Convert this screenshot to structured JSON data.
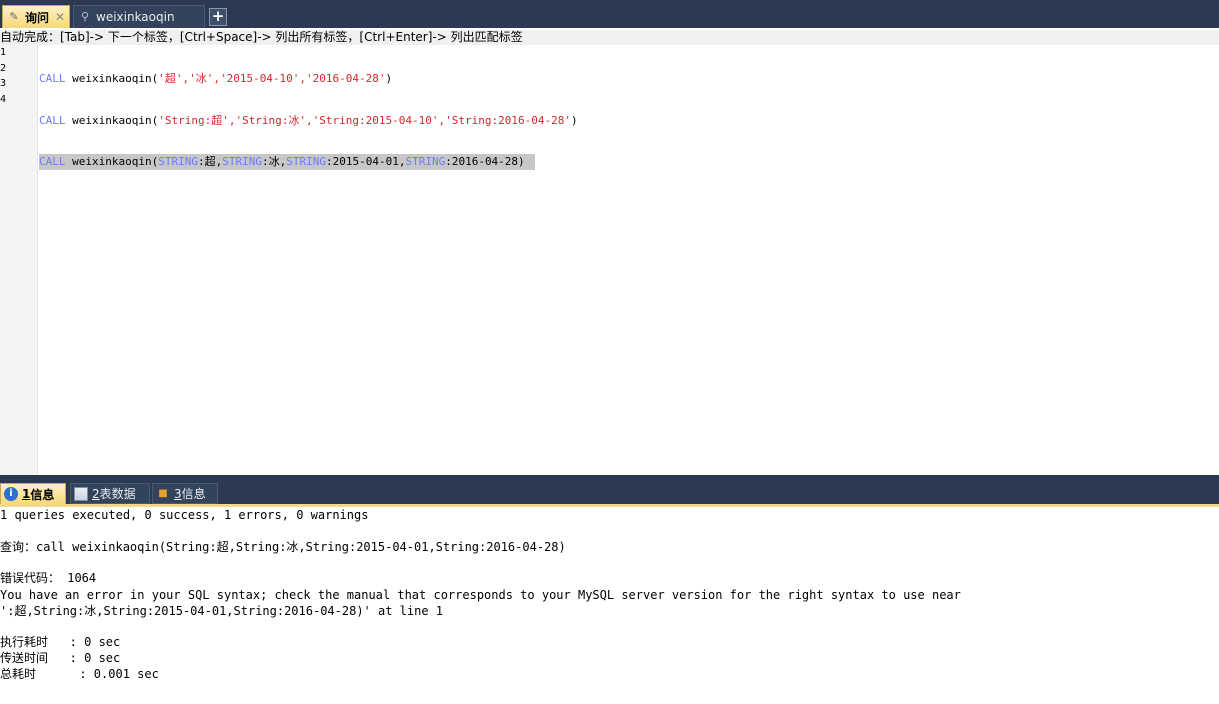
{
  "tabs": {
    "query_label": "询问",
    "query_close": "✕",
    "conn_label": "weixinkaoqin",
    "add": "+"
  },
  "hint": "自动完成：[Tab]-> 下一个标签，[Ctrl+Space]-> 列出所有标签，[Ctrl+Enter]-> 列出匹配标签",
  "editor": {
    "line_numbers": [
      "1",
      "2",
      "3",
      "4"
    ],
    "lines": [
      {
        "kw": "CALL",
        "name": " weixinkaoqin(",
        "args": "'超','冰','2015-04-10','2016-04-28'",
        "end": ")"
      },
      {
        "kw": "CALL",
        "name": " weixinkaoqin(",
        "args": "'String:超','String:冰','String:2015-04-10','String:2016-04-28'",
        "end": ")"
      },
      {
        "kw": "CALL",
        "name": " weixinkaoqin(",
        "t1": "STRING",
        "v1": ":超,",
        "t2": "STRING",
        "v2": ":冰,",
        "t3": "STRING",
        "v3": ":2015-04-01,",
        "t4": "STRING",
        "v4": ":2016-04-28)"
      }
    ]
  },
  "bottom_tabs": {
    "tab1_num": "1",
    "tab1_label": " 信息",
    "tab2_num": "2",
    "tab2_label": " 表数据",
    "tab3_num": "3",
    "tab3_label": " 信息"
  },
  "messages": {
    "summary": "1 queries executed, 0 success, 1 errors, 0 warnings",
    "query": "查询：call weixinkaoqin(String:超,String:冰,String:2015-04-01,String:2016-04-28)",
    "error_code": "错误代码： 1064",
    "error_line1": "You have an error in your SQL syntax; check the manual that corresponds to your MySQL server version for the right syntax to use near",
    "error_line2": "':超,String:冰,String:2015-04-01,String:2016-04-28)' at line 1",
    "exec_time": "执行耗时   : 0 sec",
    "transfer_time": "传送时间   : 0 sec",
    "total_time": "总耗时      : 0.001 sec"
  },
  "colors": {
    "keyword": "#6b7bff",
    "string": "#d6262c",
    "chrome": "#2b3a52",
    "active_tab": "#f6d87a"
  }
}
